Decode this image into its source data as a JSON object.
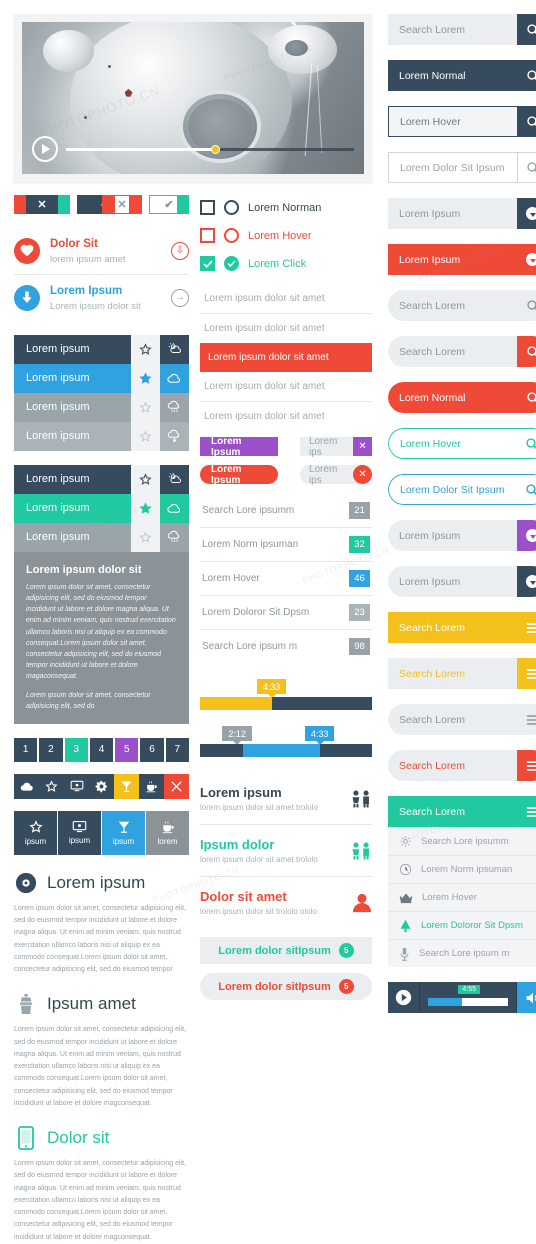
{
  "video": {
    "play_label": "play",
    "progress_percent": 52
  },
  "toggles": [
    {
      "name": "toggle-red-x",
      "glyph": "✕"
    },
    {
      "name": "toggle-navy-check",
      "glyph": "✔"
    },
    {
      "name": "toggle-outline-x",
      "glyph": "✕"
    },
    {
      "name": "toggle-outline-check",
      "glyph": "✔"
    }
  ],
  "media_rows": [
    {
      "icon": "heart-icon",
      "title": "Dolor Sit",
      "sub": "lorem ipsum amet",
      "action_icon": "download-circle-icon"
    },
    {
      "icon": "download-icon",
      "title": "Lorem Ipsum",
      "sub": "Lorem ipsum dolor sit",
      "action_icon": "arrow-right-circle-icon"
    }
  ],
  "weather_list_1": [
    {
      "label": "Lorem ipsum",
      "icon": "sun-cloud-icon"
    },
    {
      "label": "Lorem ipsum",
      "icon": "cloud-icon"
    },
    {
      "label": "Lorem ipsum",
      "icon": "rain-icon"
    },
    {
      "label": "Lorem ipsum",
      "icon": "cloud-drop-icon"
    }
  ],
  "weather_list_2": [
    {
      "label": "Lorem ipsum",
      "icon": "sun-cloud-icon"
    },
    {
      "label": "Lorem ipsum",
      "icon": "cloud-icon"
    },
    {
      "label": "Lorem ipsum",
      "icon": "rain-icon"
    }
  ],
  "weather_panel": {
    "title": "Lorem ipsum dolor sit",
    "body1": "Lorem ipsum dolor sit amet, consectetur adipisicing elit, sed do eiusmod tempor incididunt ut labore et dolore magna aliqua. Ut enim ad minim veniam, quis nostrud exercitation ullamco laboris nisi ut aliquip ex ea commodo consequat.Lorem ipsum dolor sit amet, consectetur adipisicing elit, sed do eiusmod tempor incididunt ut labore et dolore magaconsequat.",
    "body2": "Lorem ipsum dolor sit amet, consectetur adipisicing elit, sed do"
  },
  "pagination": [
    "1",
    "2",
    "3",
    "4",
    "5",
    "6",
    "7"
  ],
  "icon_toolbar": [
    "cloud-icon",
    "star-icon",
    "monitor-icon",
    "gear-icon",
    "cocktail-icon",
    "coffee-icon",
    "cutlery-icon"
  ],
  "icon_tabs": [
    {
      "icon": "star-icon",
      "label": "ipsum"
    },
    {
      "icon": "monitor-icon",
      "label": "ipsum"
    },
    {
      "icon": "cocktail-icon",
      "label": "ipsum"
    },
    {
      "icon": "coffee-icon",
      "label": "lorem"
    }
  ],
  "features": [
    {
      "icon": "disc-icon",
      "title": "Lorem ipsum",
      "body": "Lorem ipsum dolor sit amet, consectetur adipisicing elit, sed do eiusmod tempor incididunt ut labore et dolore magna aliqua. Ut enim ad minim veniam, quis nostrud exercitation ullamco laboris nisi ut aliquip ex ea commodo consequat.Lorem ipsum dolor sit amet, consectetur adipisicing elit, sed do eiusmod tempor"
    },
    {
      "icon": "brush-icon",
      "title": "Ipsum amet",
      "body": "Lorem ipsum dolor sit amet, consectetur adipisicing elit, sed do eiusmod tempor incididunt ut labore et dolore magna aliqua. Ut enim ad minim veniam, quis nostrud exercitation ullamco laboris nisi ut aliquip ex ea commodo consequat.Lorem ipsum dolor sit amet, consectetur adipisicing elit, sed do eiusmod tempor incididunt ut labore et dolore magconsequat."
    },
    {
      "icon": "phone-icon",
      "title": "Dolor sit",
      "body": "Lorem ipsum dolor sit amet, consectetur adipisicing elit, sed do eiusmod tempor incididunt ut labore et dolore magna aliqua. Ut enim ad minim veniam, quis nostrud exercitation ullamco laboris nisi ut aliquip ex ea commodo consequat.Lorem ipsum dolor sit amet, consectetur adipisicing elit, sed do eiusmod tempor incididunt ut labore et dolore magconsequat."
    }
  ],
  "choice_rows": [
    {
      "label": "Lorem Norman",
      "state": "normal"
    },
    {
      "label": "Lorem Hover",
      "state": "hover"
    },
    {
      "label": "Lorem Click",
      "state": "click"
    }
  ],
  "menu_list": [
    {
      "label": "Lorem ipsum dolor sit amet",
      "active": false
    },
    {
      "label": "Lorem ipsum dolor sit amet",
      "active": false
    },
    {
      "label": "Lorem ipsum dolor sit amet",
      "active": true
    },
    {
      "label": "Lorem ipsum dolor sit amet",
      "active": false
    },
    {
      "label": "Lorem ipsum dolor sit amet",
      "active": false
    }
  ],
  "tags": [
    {
      "label": "Lorem Ipsum",
      "input": "Lorem ips",
      "close": "✕",
      "color": "purple"
    },
    {
      "label": "Lorem Ipsum",
      "input": "Lorem ips",
      "close": "✕",
      "color": "red"
    }
  ],
  "badge_list": [
    {
      "label": "Search Lore ipsumm",
      "count": "21",
      "color": "gray"
    },
    {
      "label": "Lorem Norm ipsuman",
      "count": "32",
      "color": "teal"
    },
    {
      "label": "Lorem Hover",
      "count": "46",
      "color": "blue"
    },
    {
      "label": "Lorem Doloror Sit Dpsm",
      "count": "23",
      "color": "gray2"
    },
    {
      "label": "Search Lore ipsum m",
      "count": "98",
      "color": "gray"
    }
  ],
  "sliders": [
    {
      "tooltip": "4:33",
      "fill_percent": 42,
      "color": "yellow"
    },
    {
      "tooltip_left": "2:12",
      "tooltip_right": "4:33",
      "start_percent": 25,
      "fill_percent": 45,
      "color": "blue"
    }
  ],
  "people_rows": [
    {
      "title": "Lorem ipsum",
      "sub": "lorem ipsum dolor sit amet trololo",
      "icon": "two-people-icon",
      "color": "navy"
    },
    {
      "title": "Ipsum dolor",
      "sub": "lorem ipsum dolor sit amet trololo",
      "icon": "two-people-icon",
      "color": "teal"
    },
    {
      "title": "Dolor sit amet",
      "sub": "lorem ipsum dolor sit trololo ololo",
      "icon": "person-icon",
      "color": "red"
    }
  ],
  "pill_buttons": [
    {
      "label": "Lorem dolor sitIpsum",
      "badge": "5",
      "color": "teal"
    },
    {
      "label": "Lorem dolor sitIpsum",
      "badge": "5",
      "color": "red"
    }
  ],
  "right_fields": [
    {
      "name": "search-lorem-gray",
      "value": "Search Lorem",
      "icon": "search-icon",
      "style": "f-gray"
    },
    {
      "name": "lorem-normal-navy",
      "value": "Lorem Normal",
      "icon": "search-icon",
      "style": "f-navy"
    },
    {
      "name": "lorem-hover",
      "value": "Lorem Hover",
      "icon": "search-icon",
      "style": "f-hover"
    },
    {
      "name": "lorem-dolor-sit-ipsum-focus",
      "value": "Lorem Dolor Sit Ipsum",
      "icon": "search-icon",
      "style": "f-focus"
    },
    {
      "name": "lorem-ipsum-dropdown-gray",
      "value": "Lorem Ipsum",
      "icon": "chevron-down-icon",
      "style": "f-drop-gray"
    },
    {
      "name": "lorem-ipsum-dropdown-red",
      "value": "Lorem Ipsum",
      "icon": "chevron-down-icon",
      "style": "f-red"
    },
    {
      "name": "search-lorem-rounded-ghost",
      "value": "Search Lorem",
      "icon": "search-icon",
      "style": "rnd r-ghost"
    },
    {
      "name": "search-lorem-rounded-red",
      "value": "Search Lorem",
      "icon": "search-icon",
      "style": "rnd r-redbtn"
    },
    {
      "name": "lorem-normal-red-pill",
      "value": "Lorem Normal",
      "icon": "search-icon",
      "style": "rnd f-red"
    },
    {
      "name": "lorem-hover-teal-outline",
      "value": "Lorem Hover",
      "icon": "search-icon",
      "style": "rnd out-teal"
    },
    {
      "name": "lorem-dolor-sit-ipsum-blue-outline",
      "value": "Lorem Dolor Sit Ipsum",
      "icon": "search-icon",
      "style": "rnd out-blue"
    },
    {
      "name": "lorem-ipsum-purple-dropdown",
      "value": "Lorem Ipsum",
      "icon": "chevron-down-icon",
      "style": "rnd f-purple"
    },
    {
      "name": "lorem-ipsum-navy-dropdown",
      "value": "Lorem Ipsum",
      "icon": "chevron-down-icon",
      "style": "rnd f-navydrop"
    },
    {
      "name": "search-lorem-yellow",
      "value": "Search Lorem",
      "icon": "menu-icon",
      "style": "f-yellow"
    },
    {
      "name": "search-lorem-yellow-ghost",
      "value": "Search Lorem",
      "icon": "menu-icon",
      "style": "f-yellowghost"
    },
    {
      "name": "search-lorem-rounded-menu-gray",
      "value": "Search Lorem",
      "icon": "menu-icon",
      "style": "rnd r-greytext"
    },
    {
      "name": "search-lorem-rounded-menu-red",
      "value": "Search Lorem",
      "icon": "menu-icon",
      "style": "rnd r-redtext"
    },
    {
      "name": "search-lorem-teal",
      "value": "Search Lorem",
      "icon": "menu-icon",
      "style": "f-teal"
    }
  ],
  "dropdown_menu": [
    {
      "label": "Search Lore ipsumm",
      "icon": "gear-icon",
      "active": false
    },
    {
      "label": "Lorem Norm ipsuman",
      "icon": "clock-icon",
      "active": false
    },
    {
      "label": "Lorem Hover",
      "icon": "crown-icon",
      "active": false
    },
    {
      "label": "Lorem Doloror Sit Dpsm",
      "icon": "tree-icon",
      "active": true
    },
    {
      "label": "Search Lore ipsum m",
      "icon": "mic-icon",
      "active": false
    }
  ],
  "media_player": {
    "play_icon": "play-icon",
    "volume_icon": "volume-icon",
    "time": "4:55",
    "fill_percent": 42
  },
  "colors": {
    "navy": "#374b5e",
    "red": "#ef4a38",
    "teal": "#20c9a0",
    "blue": "#31a2e0",
    "yellow": "#f4c01c",
    "purple": "#9b4fc8",
    "gray": "#98a3a9"
  }
}
